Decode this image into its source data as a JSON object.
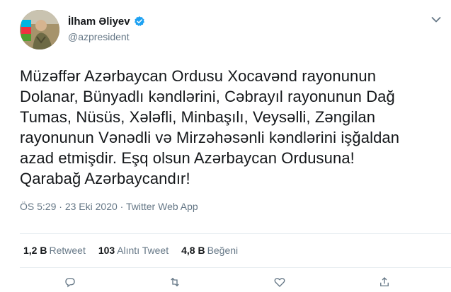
{
  "author": {
    "display_name": "İlham Əliyev",
    "handle": "@azpresident",
    "verified": true
  },
  "tweet": {
    "lines": [
      "Müzəffər Azərbaycan Ordusu Xocavənd rayonunun",
      "Dolanar, Bünyadlı kəndlərini, Cəbrayıl rayonunun Dağ",
      "Tumas, Nüsüs, Xələfli, Minbaşılı, Veysəlli, Zəngilan",
      "rayonunun Vənədli və Mirzəhəsənli kəndlərini işğaldan",
      "azad etmişdir. Eşq olsun Azərbaycan Ordusuna!",
      "Qarabağ Azərbaycandır!"
    ],
    "time": "ÖS 5:29",
    "separator": "·",
    "date": "23 Eki 2020",
    "source": "Twitter Web App"
  },
  "stats": {
    "retweets": {
      "count": "1,2 B",
      "label": "Retweet"
    },
    "quotes": {
      "count": "103",
      "label": "Alıntı Tweet"
    },
    "likes": {
      "count": "4,8 B",
      "label": "Beğeni"
    }
  },
  "icons": {
    "verified": "verified-badge-icon",
    "menu": "chevron-down-icon",
    "reply": "reply-icon",
    "retweet": "retweet-icon",
    "like": "heart-icon",
    "share": "share-icon"
  },
  "colors": {
    "verified_blue": "#1da1f2",
    "text": "#14171a",
    "muted": "#657786",
    "divider": "#e6ecf0"
  }
}
